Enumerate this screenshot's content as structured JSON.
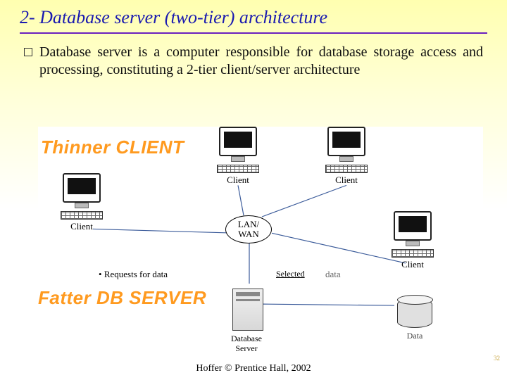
{
  "title": "2- Database server (two-tier) architecture",
  "bullet_text": "Database server is a computer responsible for database storage access and processing, constituting a 2-tier client/server architecture",
  "labels": {
    "thinner_client": "Thinner CLIENT",
    "fatter_server": "Fatter DB SERVER",
    "client": "Client",
    "lanwan_line1": "LAN/",
    "lanwan_line2": "WAN",
    "requests": "Requests for data",
    "selected": "Selected",
    "data": "data",
    "db_server_line1": "Database",
    "db_server_line2": "Server",
    "data_cyl": "Data"
  },
  "footer": "Hoffer © Prentice Hall, 2002",
  "page_number": "32"
}
